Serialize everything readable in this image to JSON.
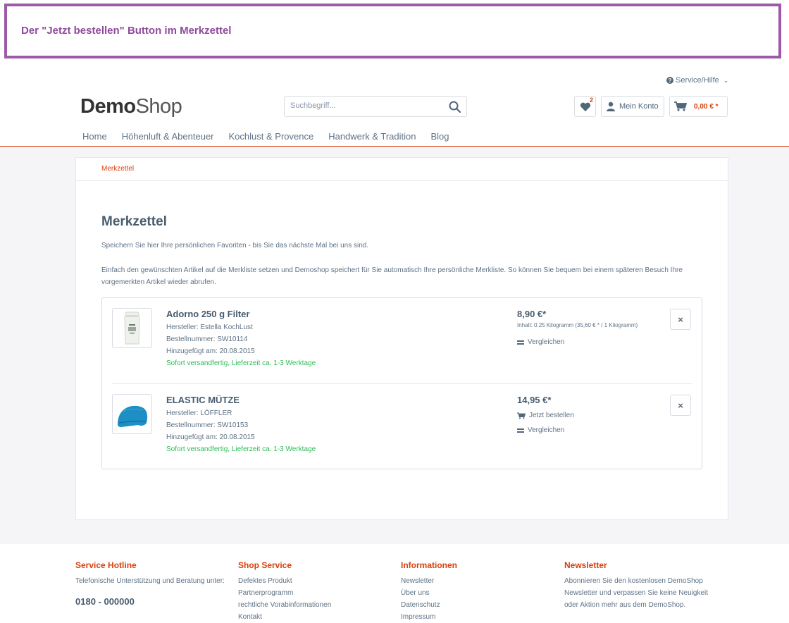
{
  "annotation": {
    "text": "Der \"Jetzt bestellen\" Button im Merkzettel"
  },
  "header": {
    "service_label": "Service/Hilfe",
    "logo_bold": "Demo",
    "logo_light": "Shop",
    "search_placeholder": "Suchbegriff...",
    "wishlist_count": "2",
    "account_label": "Mein Konto",
    "cart_amount": "0,00 € *"
  },
  "nav": {
    "items": [
      "Home",
      "Höhenluft & Abenteuer",
      "Kochlust & Provence",
      "Handwerk & Tradition",
      "Blog"
    ]
  },
  "breadcrumb": "Merkzettel",
  "page": {
    "title": "Merkzettel",
    "desc1": "Speichern Sie hier Ihre persönlichen Favoriten - bis Sie das nächste Mal bei uns sind.",
    "desc2": "Einfach den gewünschten Artikel auf die Merkliste setzen und Demoshop speichert für Sie automatisch Ihre persönliche Merkliste. So können Sie bequem bei einem späteren Besuch Ihre vorgemerkten Artikel wieder abrufen."
  },
  "items": [
    {
      "name": "Adorno 250 g Filter",
      "manufacturer": "Hersteller: Estella KochLust",
      "order_number": "Bestellnummer: SW10114",
      "added": "Hinzugefügt am: 20.08.2015",
      "shipping": "Sofort versandfertig, Lieferzeit ca. 1-3 Werktage",
      "price": "8,90 €*",
      "unit_price": "Inhalt: 0.25 Kilogramm (35,60 € * / 1 Kilogramm)",
      "compare_label": "Vergleichen",
      "remove_label": "×"
    },
    {
      "name": "ELASTIC MÜTZE",
      "manufacturer": "Hersteller: LÖFFLER",
      "order_number": "Bestellnummer: SW10153",
      "added": "Hinzugefügt am: 20.08.2015",
      "shipping": "Sofort versandfertig, Lieferzeit ca. 1-3 Werktage",
      "price": "14,95 €*",
      "order_now_label": "Jetzt bestellen",
      "compare_label": "Vergleichen",
      "remove_label": "×"
    }
  ],
  "footer": {
    "col1": {
      "title": "Service Hotline",
      "text": "Telefonische Unterstützung und Beratung unter:",
      "phone": "0180 - 000000"
    },
    "col2": {
      "title": "Shop Service",
      "links": [
        "Defektes Produkt",
        "Partnerprogramm",
        "rechtliche Vorabinformationen",
        "Kontakt"
      ]
    },
    "col3": {
      "title": "Informationen",
      "links": [
        "Newsletter",
        "Über uns",
        "Datenschutz",
        "Impressum"
      ]
    },
    "col4": {
      "title": "Newsletter",
      "text": "Abonnieren Sie den kostenlosen DemoShop Newsletter und verpassen Sie keine Neuigkeit oder Aktion mehr aus dem DemoShop."
    }
  },
  "colors": {
    "accent": "#d9400b",
    "annotation": "#9e5aa8",
    "shipping": "#2ebd59"
  }
}
